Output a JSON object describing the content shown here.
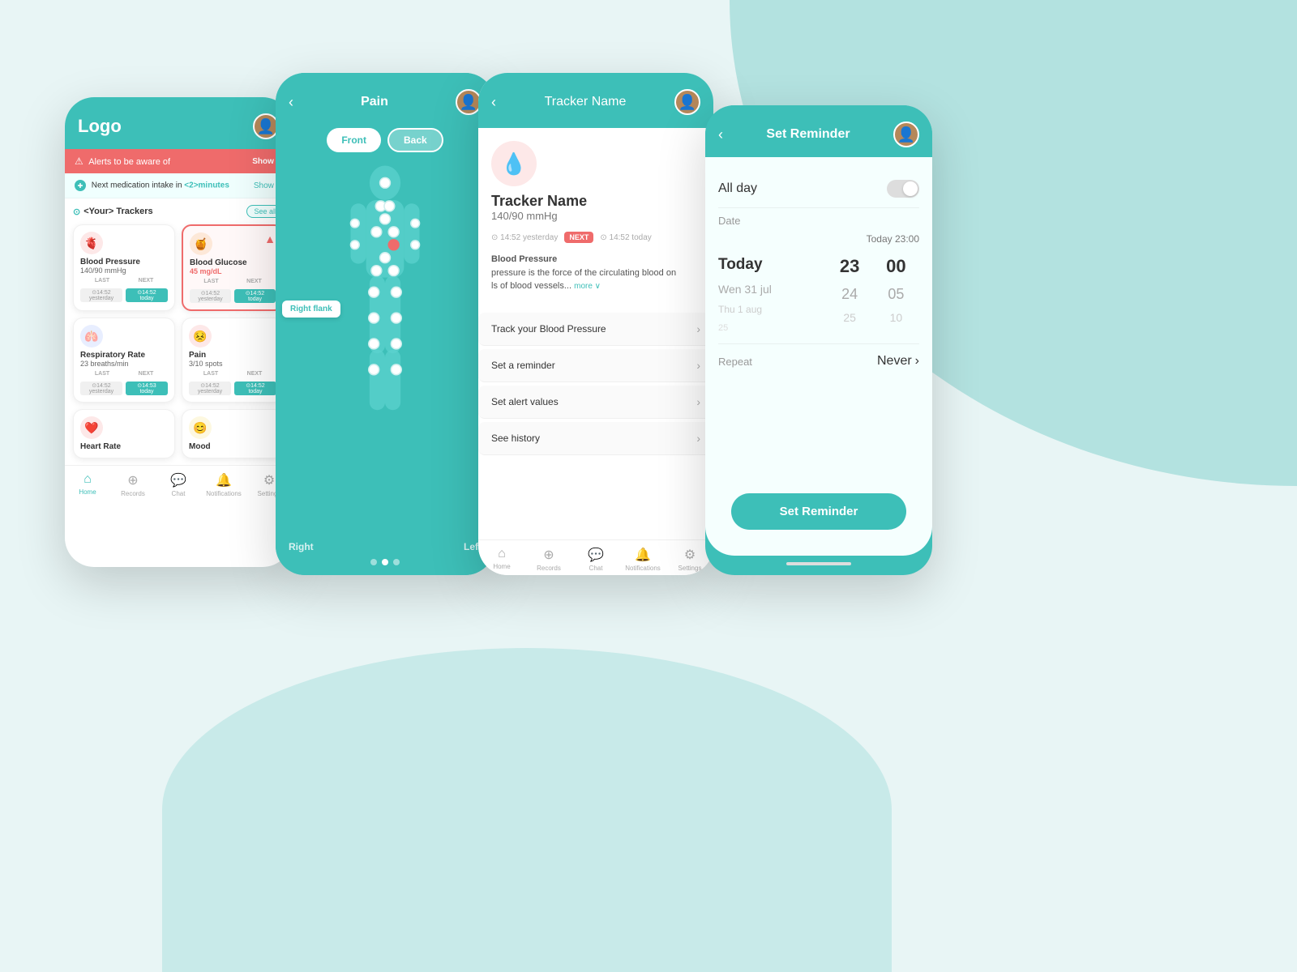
{
  "background": {
    "color1": "#e8f5f5",
    "color2": "#7ecfcc"
  },
  "screen1": {
    "logo": "Logo",
    "alert_text": "Alerts to be aware of",
    "alert_show": "Show ∨",
    "med_text": "Next medication intake in ",
    "med_time": "<2>minutes",
    "med_show": "Show ∨",
    "trackers_title": "<Your> Trackers",
    "see_all": "See all",
    "trackers": [
      {
        "name": "Blood Pressure",
        "value": "140/90 mmHg",
        "icon": "🫀",
        "icon_class": "icon-red",
        "highlighted": false,
        "last": "⊙14:52 yesterday",
        "next": "⊙14:52 today"
      },
      {
        "name": "Blood Glucose",
        "value": "45 mg/dL",
        "icon": "🍯",
        "icon_class": "icon-orange",
        "highlighted": true,
        "last": "⊙14:52 yesterday",
        "next": "⊙14:52 today"
      },
      {
        "name": "Respiratory Rate",
        "value": "23 breaths/min",
        "icon": "🫁",
        "icon_class": "icon-blue",
        "highlighted": false,
        "last": "⊙14:52 yesterday",
        "next": "⊙14:53 today"
      },
      {
        "name": "Pain",
        "value": "3/10 spots",
        "icon": "😣",
        "icon_class": "icon-pink",
        "highlighted": false,
        "last": "⊙14:52 yesterday",
        "next": "⊙14:52 today"
      },
      {
        "name": "Heart Rate",
        "value": "",
        "icon": "❤️",
        "icon_class": "icon-red",
        "highlighted": false,
        "last": "",
        "next": ""
      },
      {
        "name": "Mood",
        "value": "",
        "icon": "😊",
        "icon_class": "icon-yellow",
        "highlighted": false,
        "last": "",
        "next": ""
      }
    ],
    "nav": [
      {
        "label": "Home",
        "icon": "⌂",
        "active": true
      },
      {
        "label": "Records",
        "icon": "+",
        "active": false
      },
      {
        "label": "Chat",
        "icon": "💬",
        "active": false
      },
      {
        "label": "Notifications",
        "icon": "🔔",
        "active": false
      },
      {
        "label": "Settings",
        "icon": "⚙",
        "active": false
      }
    ]
  },
  "screen2": {
    "title": "Pain",
    "front_label": "Front",
    "back_label": "Back",
    "right_flank_label": "Right flank",
    "bottom_right": "Right",
    "bottom_left": "Left"
  },
  "screen3": {
    "title": "Tracker Name",
    "tracker_icon": "💧",
    "tracker_name": "Tracker Name",
    "tracker_value": "140/90 mmHg",
    "time_last": "⊙ 14:52 yesterday",
    "time_next": "⊙ 14:52 today",
    "next_label": "NEXT",
    "description": "Blood Pressure\npressure is the force of the circulating blood on\nls of blood vessels...",
    "more_label": "more ∨",
    "actions": [
      {
        "label": "Track your Blood Pressure",
        "chevron": "›"
      },
      {
        "label": "Set a reminder",
        "chevron": "›"
      },
      {
        "label": "Set alert values",
        "chevron": "›"
      },
      {
        "label": "See history",
        "chevron": "›"
      }
    ],
    "nav": [
      {
        "label": "Home",
        "icon": "⌂",
        "active": false
      },
      {
        "label": "Records",
        "icon": "+",
        "active": false
      },
      {
        "label": "Chat",
        "icon": "💬",
        "active": false
      },
      {
        "label": "Notifications",
        "icon": "🔔",
        "active": false
      },
      {
        "label": "Settings",
        "icon": "⚙",
        "active": false
      }
    ]
  },
  "screen4": {
    "title": "Set Reminder",
    "all_day_label": "All day",
    "date_label": "Date",
    "today_time": "Today 23:00",
    "days": [
      {
        "label": "Today",
        "state": "selected"
      },
      {
        "label": "Wen 31 jul",
        "state": "semi"
      },
      {
        "label": "Thu 1 aug",
        "state": "normal"
      },
      {
        "label": "25",
        "state": "normal"
      }
    ],
    "hours": [
      "23",
      "24",
      "25"
    ],
    "minutes": [
      "00",
      "05",
      "10"
    ],
    "never_label": "Never",
    "set_reminder_btn": "Set Reminder"
  }
}
